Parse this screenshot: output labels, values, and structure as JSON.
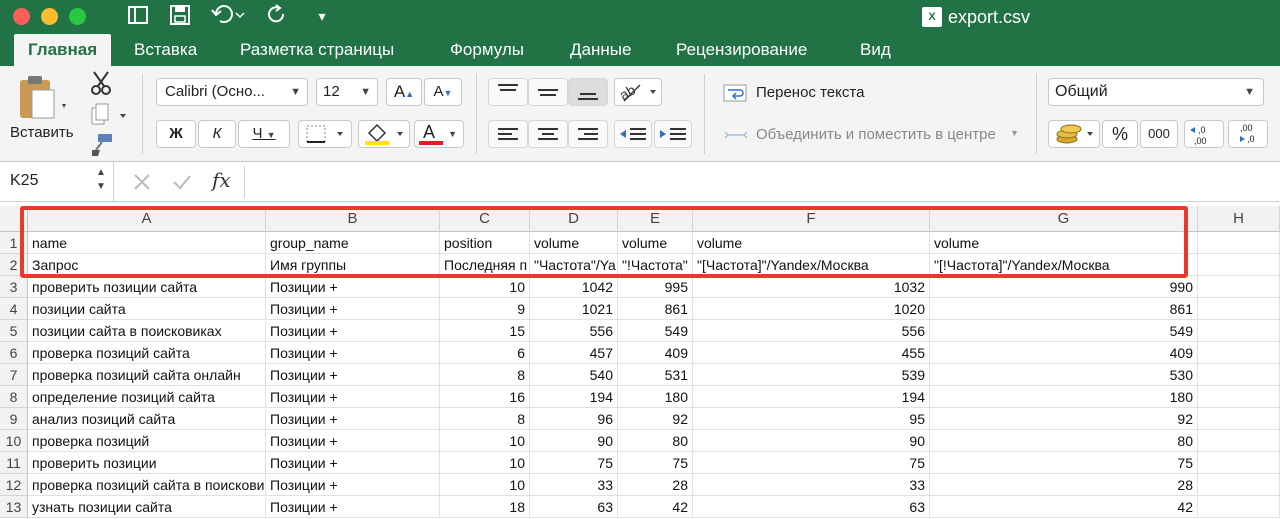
{
  "window": {
    "title": "export.csv",
    "file_badge": "X"
  },
  "toolbar_icons": [
    "sidebar-icon",
    "save-icon",
    "undo-icon",
    "redo-icon",
    "customize-icon"
  ],
  "tabs": [
    "Главная",
    "Вставка",
    "Разметка страницы",
    "Формулы",
    "Данные",
    "Рецензирование",
    "Вид"
  ],
  "ribbon": {
    "paste_label": "Вставить",
    "font_name": "Calibri (Осно...",
    "font_size": "12",
    "grow_font": "A",
    "shrink_font": "A",
    "bold": "Ж",
    "italic": "К",
    "underline": "Ч",
    "font_color_glyph": "A",
    "wrap_text": "Перенос текста",
    "merge_center": "Объединить и поместить в центре",
    "number_format": "Общий",
    "percent": "%",
    "thousands": "000",
    "inc_decimal": "←,0 ,00",
    "dec_decimal": ",00 →,0",
    "accent_fill": "#ffe600",
    "accent_font": "#e01e1e"
  },
  "formula_bar": {
    "cell_ref": "K25",
    "fx": "fx",
    "value": ""
  },
  "columns": [
    "A",
    "B",
    "C",
    "D",
    "E",
    "F",
    "G",
    "H"
  ],
  "rows": [
    {
      "n": "1",
      "cells": [
        "name",
        "group_name",
        "position",
        "volume",
        "volume",
        "volume",
        "volume"
      ]
    },
    {
      "n": "2",
      "cells": [
        "Запрос",
        "Имя группы",
        "Последняя п",
        "\"Частота\"/Ya",
        "\"!Частота\"",
        "\"[Частота]\"/Yandex/Москва",
        "\"[!Частота]\"/Yandex/Москва"
      ]
    },
    {
      "n": "3",
      "cells": [
        "проверить позиции сайта",
        "Позиции +",
        "10",
        "1042",
        "995",
        "1032",
        "990"
      ]
    },
    {
      "n": "4",
      "cells": [
        "позиции сайта",
        "Позиции +",
        "9",
        "1021",
        "861",
        "1020",
        "861"
      ]
    },
    {
      "n": "5",
      "cells": [
        "позиции сайта в поисковиках",
        "Позиции +",
        "15",
        "556",
        "549",
        "556",
        "549"
      ]
    },
    {
      "n": "6",
      "cells": [
        "проверка позиций сайта",
        "Позиции +",
        "6",
        "457",
        "409",
        "455",
        "409"
      ]
    },
    {
      "n": "7",
      "cells": [
        "проверка позиций сайта онлайн",
        "Позиции +",
        "8",
        "540",
        "531",
        "539",
        "530"
      ]
    },
    {
      "n": "8",
      "cells": [
        "определение позиций сайта",
        "Позиции +",
        "16",
        "194",
        "180",
        "194",
        "180"
      ]
    },
    {
      "n": "9",
      "cells": [
        "анализ позиций сайта",
        "Позиции +",
        "8",
        "96",
        "92",
        "95",
        "92"
      ]
    },
    {
      "n": "10",
      "cells": [
        "проверка позиций",
        "Позиции +",
        "10",
        "90",
        "80",
        "90",
        "80"
      ]
    },
    {
      "n": "11",
      "cells": [
        "проверить позиции",
        "Позиции +",
        "10",
        "75",
        "75",
        "75",
        "75"
      ]
    },
    {
      "n": "12",
      "cells": [
        "проверка позиций сайта в поисковиках",
        "Позиции +",
        "10",
        "33",
        "28",
        "33",
        "28"
      ]
    },
    {
      "n": "13",
      "cells": [
        "узнать позиции сайта",
        "Позиции +",
        "18",
        "63",
        "42",
        "63",
        "42"
      ]
    }
  ],
  "colors": {
    "titlebar": "#217346",
    "highlight": "#e8392b"
  }
}
